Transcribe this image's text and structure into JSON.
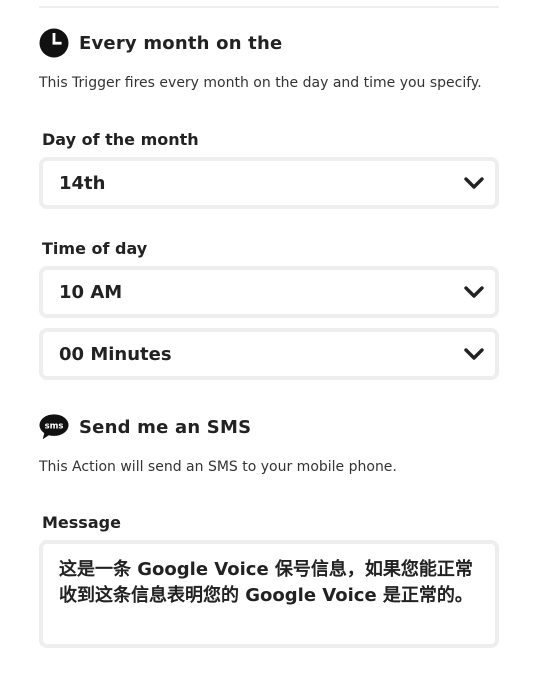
{
  "trigger": {
    "icon": "clock-icon",
    "title": "Every month on the",
    "description": "This Trigger fires every month on the day and time you specify.",
    "day_of_month": {
      "label": "Day of the month",
      "value": "14th"
    },
    "time_of_day": {
      "label": "Time of day",
      "hour": "10 AM",
      "minutes": "00 Minutes"
    }
  },
  "action": {
    "icon": "sms-icon",
    "icon_text": "sms",
    "title": "Send me an SMS",
    "description": "This Action will send an SMS to your mobile phone.",
    "message": {
      "label": "Message",
      "value": "这是一条 Google Voice 保号信息，如果您能正常收到这条信息表明您的 Google Voice 是正常的。"
    }
  },
  "colors": {
    "text": "#222222",
    "field_border": "#eeeeee",
    "icon": "#111111"
  }
}
